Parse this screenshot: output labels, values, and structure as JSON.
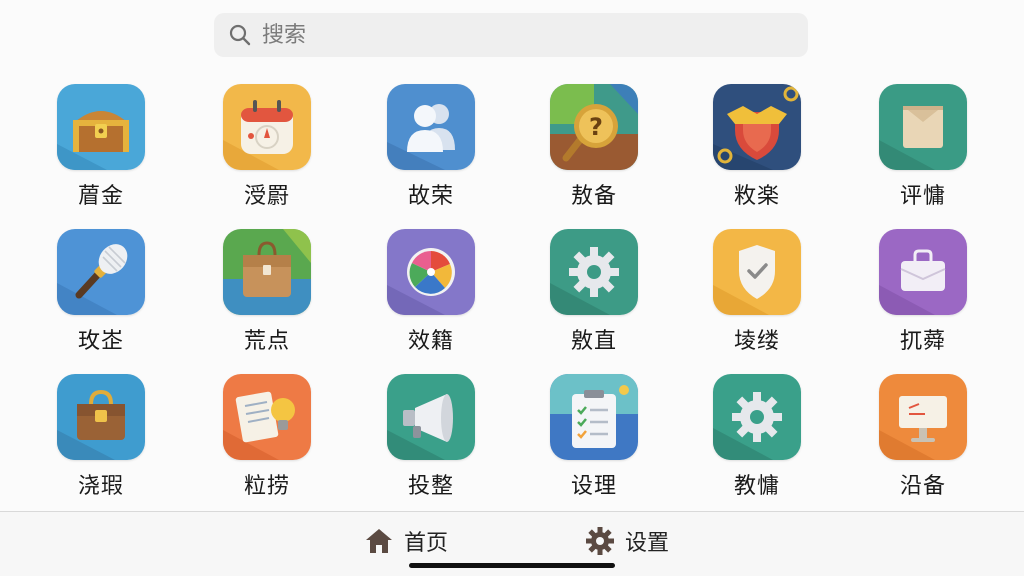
{
  "search": {
    "placeholder": "搜索"
  },
  "apps": [
    {
      "label": "葿金",
      "icon": "treasure-chest-icon"
    },
    {
      "label": "涭罻",
      "icon": "calendar-icon"
    },
    {
      "label": "故荣",
      "icon": "contacts-icon"
    },
    {
      "label": "敖备",
      "icon": "help-coin-icon"
    },
    {
      "label": "敉楽",
      "icon": "shield-badge-icon"
    },
    {
      "label": "评慵",
      "icon": "box-icon"
    },
    {
      "label": "玫峜",
      "icon": "torch-icon"
    },
    {
      "label": "荒点",
      "icon": "backpack-icon"
    },
    {
      "label": "效籍",
      "icon": "color-wheel-icon"
    },
    {
      "label": "敫直",
      "icon": "gear-icon"
    },
    {
      "label": "堎缕",
      "icon": "security-shield-icon"
    },
    {
      "label": "扤蕣",
      "icon": "briefcase-icon"
    },
    {
      "label": "浇瑕",
      "icon": "bag-icon"
    },
    {
      "label": "粒捞",
      "icon": "notes-idea-icon"
    },
    {
      "label": "投整",
      "icon": "megaphone-icon"
    },
    {
      "label": "设理",
      "icon": "clipboard-icon"
    },
    {
      "label": "教慵",
      "icon": "settings-gear-icon"
    },
    {
      "label": "沿备",
      "icon": "presentation-icon"
    }
  ],
  "nav": {
    "home_label": "首页",
    "settings_label": "设置"
  },
  "colors": {
    "background": "#fbfbfb",
    "search_bg": "#efefef",
    "nav_icon": "#5b4a42"
  }
}
